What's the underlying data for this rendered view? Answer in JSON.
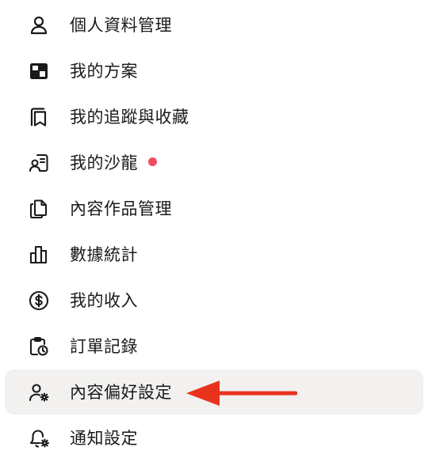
{
  "menu": {
    "items": [
      {
        "label": "個人資料管理",
        "icon": "person-icon"
      },
      {
        "label": "我的方案",
        "icon": "plan-icon"
      },
      {
        "label": "我的追蹤與收藏",
        "icon": "bookmark-icon"
      },
      {
        "label": "我的沙龍",
        "icon": "salon-icon",
        "notification_dot": true
      },
      {
        "label": "內容作品管理",
        "icon": "documents-icon"
      },
      {
        "label": "數據統計",
        "icon": "bar-chart-icon"
      },
      {
        "label": "我的收入",
        "icon": "dollar-icon"
      },
      {
        "label": "訂單記錄",
        "icon": "order-history-icon"
      },
      {
        "label": "內容偏好設定",
        "icon": "user-gear-icon",
        "selected": true
      },
      {
        "label": "通知設定",
        "icon": "bell-gear-icon"
      }
    ]
  },
  "colors": {
    "text": "#1a1a1a",
    "active_background": "#f2f1ef",
    "notification_dot": "#ef4a5e",
    "arrow": "#e8321e"
  }
}
